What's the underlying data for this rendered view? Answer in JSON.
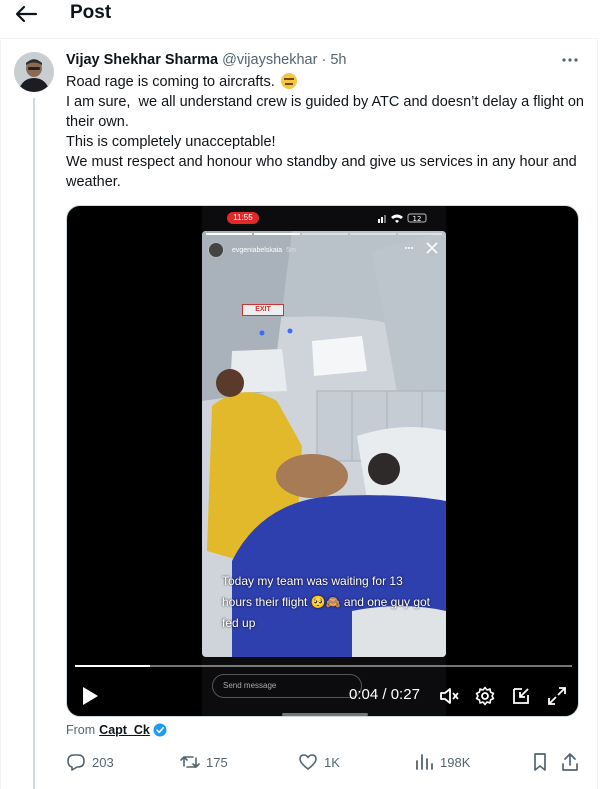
{
  "header": {
    "title": "Post"
  },
  "post": {
    "author_name": "Vijay Shekhar Sharma",
    "author_handle": "@vijayshekhar",
    "separator": "·",
    "time": "5h",
    "text_line_1": "Road rage is coming to aircrafts. ",
    "text_emoji": "expressionless-face",
    "text_lines": [
      "I am sure,  we all understand crew is guided by ATC and doesn’t delay a flight on their own.",
      "This is completely unacceptable!",
      "We must respect and honour who standby and give us services in any hour and weather."
    ]
  },
  "video": {
    "status_time": "11:55",
    "status_battery": "12",
    "story_username": "evgeniabelskaia",
    "story_time": "5m",
    "exit_sign": "EXIT",
    "caption": "Today my team was waiting for 13 hours their flight 🥺🙈 and one guy got fed up",
    "send_message_placeholder": "Send message",
    "current_time": "0:04",
    "time_separator": "/",
    "duration": "0:27",
    "progress": 0.15
  },
  "source": {
    "from_label": "From",
    "source_name": "Capt_Ck"
  },
  "actions": {
    "replies": "203",
    "reposts": "175",
    "likes": "1K",
    "views": "198K"
  },
  "colors": {
    "text": "#0f1419",
    "muted": "#536471",
    "verified": "#1d9bf0",
    "divider": "#eff3f4"
  }
}
